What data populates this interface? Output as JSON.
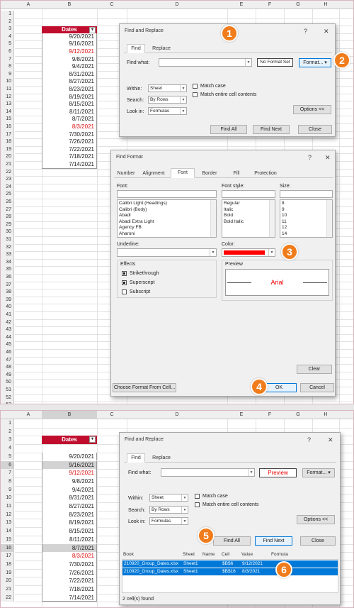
{
  "columns": [
    "A",
    "B",
    "C",
    "D",
    "E",
    "F",
    "G",
    "H"
  ],
  "row_numbers": [
    "1",
    "2",
    "3",
    "4",
    "5",
    "6",
    "7",
    "8",
    "9",
    "10",
    "11",
    "12",
    "13",
    "14",
    "15",
    "16",
    "17",
    "18",
    "19",
    "20",
    "21",
    "22",
    "23",
    "24",
    "25",
    "26",
    "27",
    "28",
    "29",
    "30",
    "31",
    "32",
    "33",
    "34",
    "35",
    "36",
    "37",
    "38",
    "39",
    "40",
    "41",
    "42",
    "43",
    "44",
    "45",
    "46",
    "47",
    "48",
    "49",
    "50",
    "51",
    "52",
    "53"
  ],
  "row_numbers_bottom": [
    "1",
    "2",
    "3",
    "4",
    "5",
    "6",
    "7",
    "8",
    "9",
    "10",
    "11",
    "12",
    "13",
    "14",
    "15",
    "16",
    "17",
    "18",
    "19",
    "20",
    "21",
    "22"
  ],
  "table_header": "Dates",
  "filter_symbol": "▾",
  "dates": [
    "9/20/2021",
    "9/16/2021",
    "9/12/2021",
    "9/8/2021",
    "9/4/2021",
    "8/31/2021",
    "8/27/2021",
    "8/23/2021",
    "8/19/2021",
    "8/15/2021",
    "8/11/2021",
    "8/7/2021",
    "8/3/2021",
    "7/30/2021",
    "7/26/2021",
    "7/22/2021",
    "7/18/2021",
    "7/14/2021"
  ],
  "find_replace_top": {
    "title": "Find and Replace",
    "help": "?",
    "close": "✕",
    "tabs": [
      "Find",
      "Replace"
    ],
    "find_what_label": "Find what:",
    "find_what_value": "",
    "format_preview": "No Format Set",
    "format_button": "Format...",
    "within_label": "Within:",
    "within_value": "Sheet",
    "search_label": "Search:",
    "search_value": "By Rows",
    "look_in_label": "Look in:",
    "look_in_value": "Formulas",
    "match_case": "Match case",
    "match_entire": "Match entire cell contents",
    "options_button": "Options <<",
    "find_all": "Find All",
    "find_next": "Find Next",
    "close_button": "Close"
  },
  "find_format": {
    "title": "Find Format",
    "help": "?",
    "close": "✕",
    "tabs": [
      "Number",
      "Alignment",
      "Font",
      "Border",
      "Fill",
      "Protection"
    ],
    "font_label": "Font:",
    "fonts": [
      "Calibri Light (Headings)",
      "Calibri (Body)",
      "Abadi",
      "Abadi Extra Light",
      "Agency FB",
      "Aharoni"
    ],
    "font_style_label": "Font style:",
    "font_styles": [
      "Regular",
      "Italic",
      "Bold",
      "Bold Italic"
    ],
    "size_label": "Size:",
    "sizes": [
      "8",
      "9",
      "10",
      "11",
      "12",
      "14"
    ],
    "underline_label": "Underline:",
    "color_label": "Color:",
    "color_value": "#ff0000",
    "effects_label": "Effects",
    "strikethrough": "Strikethrough",
    "superscript": "Superscript",
    "subscript": "Subscript",
    "preview_label": "Preview",
    "preview_text": "Arial",
    "clear_button": "Clear",
    "choose_format_button": "Choose Format From Cell...",
    "ok_button": "OK",
    "cancel_button": "Cancel"
  },
  "find_replace_bottom": {
    "title": "Find and Replace",
    "help": "?",
    "close": "✕",
    "tabs": [
      "Find",
      "Replace"
    ],
    "find_what_label": "Find what:",
    "format_preview": "Preview",
    "format_button": "Format...",
    "within_label": "Within:",
    "within_value": "Sheet",
    "search_label": "Search:",
    "search_value": "By Rows",
    "look_in_label": "Look in:",
    "look_in_value": "Formulas",
    "match_case": "Match case",
    "match_entire": "Match entire cell contents",
    "options_button": "Options <<",
    "find_all": "Find All",
    "find_next": "Find Next",
    "close_button": "Close",
    "result_headers": [
      "Book",
      "Sheet",
      "Name",
      "Cell",
      "Value",
      "Formula"
    ],
    "results": [
      {
        "book": "210920_Group_Dates.xlsx",
        "sheet": "Sheet1",
        "name": "",
        "cell": "$B$6",
        "value": "9/12/2021",
        "formula": ""
      },
      {
        "book": "210920_Group_Dates.xlsx",
        "sheet": "Sheet1",
        "name": "",
        "cell": "$B$16",
        "value": "8/3/2021",
        "formula": ""
      }
    ],
    "status": "2 cell(s) found"
  },
  "badges": [
    "1",
    "2",
    "3",
    "4",
    "5",
    "6"
  ],
  "colors": {
    "accent": "#c00d2e",
    "badge": "#f07c1c",
    "selection": "#0078d7",
    "font_color": "#ff0000"
  }
}
